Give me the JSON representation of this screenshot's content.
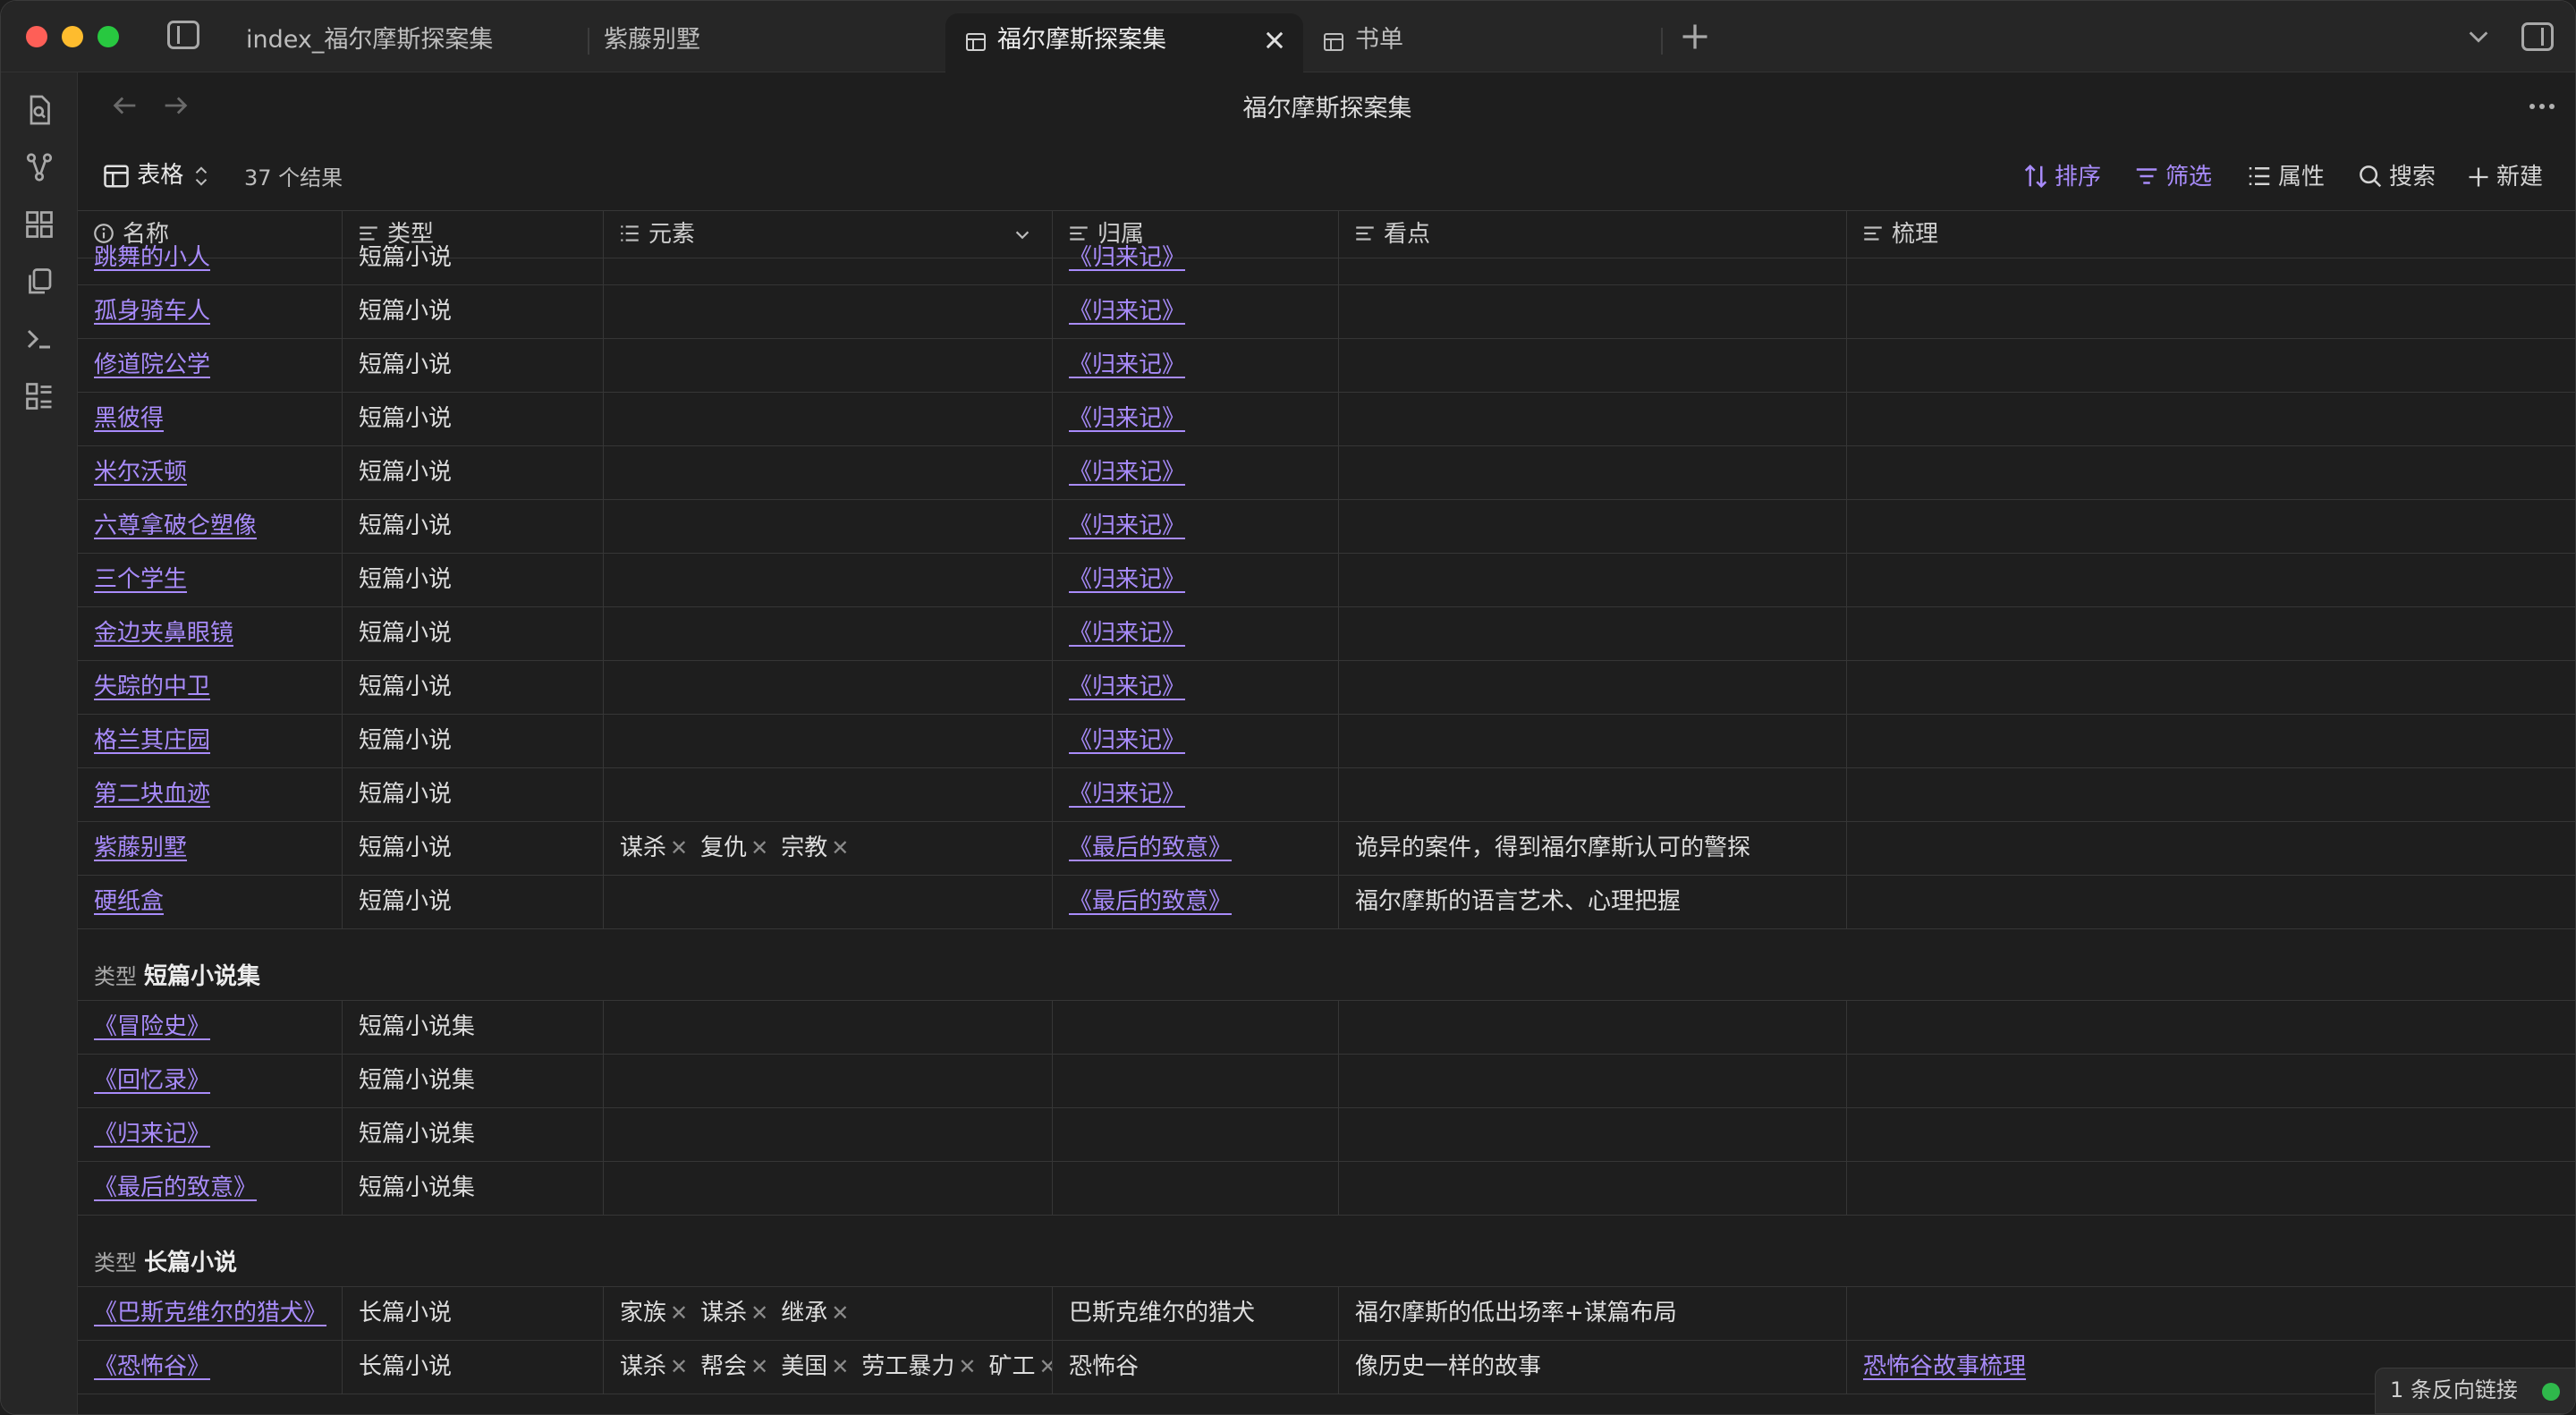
{
  "tabs": [
    {
      "label": "index_福尔摩斯探案集",
      "active": false
    },
    {
      "label": "紫藤别墅",
      "active": false
    },
    {
      "label": "福尔摩斯探案集",
      "active": true
    },
    {
      "label": "书单",
      "active": false
    }
  ],
  "page": {
    "title": "福尔摩斯探案集"
  },
  "toolbar": {
    "view_label": "表格",
    "result_count": "37 个结果",
    "sort_label": "排序",
    "filter_label": "筛选",
    "properties_label": "属性",
    "search_label": "搜索",
    "new_label": "新建"
  },
  "columns": {
    "name": "名称",
    "type": "类型",
    "elements": "元素",
    "belongs": "归属",
    "highlights": "看点",
    "notes": "梳理"
  },
  "rows_group1": [
    {
      "name": "跳舞的小人",
      "type": "短篇小说",
      "elements": [],
      "belongs": "《归来记》",
      "highlights": "",
      "notes": ""
    },
    {
      "name": "孤身骑车人",
      "type": "短篇小说",
      "elements": [],
      "belongs": "《归来记》",
      "highlights": "",
      "notes": ""
    },
    {
      "name": "修道院公学",
      "type": "短篇小说",
      "elements": [],
      "belongs": "《归来记》",
      "highlights": "",
      "notes": ""
    },
    {
      "name": "黑彼得",
      "type": "短篇小说",
      "elements": [],
      "belongs": "《归来记》",
      "highlights": "",
      "notes": ""
    },
    {
      "name": "米尔沃顿",
      "type": "短篇小说",
      "elements": [],
      "belongs": "《归来记》",
      "highlights": "",
      "notes": ""
    },
    {
      "name": "六尊拿破仑塑像",
      "type": "短篇小说",
      "elements": [],
      "belongs": "《归来记》",
      "highlights": "",
      "notes": ""
    },
    {
      "name": "三个学生",
      "type": "短篇小说",
      "elements": [],
      "belongs": "《归来记》",
      "highlights": "",
      "notes": ""
    },
    {
      "name": "金边夹鼻眼镜",
      "type": "短篇小说",
      "elements": [],
      "belongs": "《归来记》",
      "highlights": "",
      "notes": ""
    },
    {
      "name": "失踪的中卫",
      "type": "短篇小说",
      "elements": [],
      "belongs": "《归来记》",
      "highlights": "",
      "notes": ""
    },
    {
      "name": "格兰其庄园",
      "type": "短篇小说",
      "elements": [],
      "belongs": "《归来记》",
      "highlights": "",
      "notes": ""
    },
    {
      "name": "第二块血迹",
      "type": "短篇小说",
      "elements": [],
      "belongs": "《归来记》",
      "highlights": "",
      "notes": ""
    },
    {
      "name": "紫藤别墅",
      "type": "短篇小说",
      "elements": [
        "谋杀",
        "复仇",
        "宗教"
      ],
      "belongs": "《最后的致意》",
      "highlights": "诡异的案件，得到福尔摩斯认可的警探",
      "notes": ""
    },
    {
      "name": "硬纸盒",
      "type": "短篇小说",
      "elements": [],
      "belongs": "《最后的致意》",
      "highlights": "福尔摩斯的语言艺术、心理把握",
      "notes": ""
    }
  ],
  "group2": {
    "label": "类型",
    "value": "短篇小说集"
  },
  "rows_group2": [
    {
      "name": "《冒险史》",
      "type": "短篇小说集"
    },
    {
      "name": "《回忆录》",
      "type": "短篇小说集"
    },
    {
      "name": "《归来记》",
      "type": "短篇小说集"
    },
    {
      "name": "《最后的致意》",
      "type": "短篇小说集"
    }
  ],
  "group3": {
    "label": "类型",
    "value": "长篇小说"
  },
  "rows_group3": [
    {
      "name": "《巴斯克维尔的猎犬》",
      "type": "长篇小说",
      "elements": [
        "家族",
        "谋杀",
        "继承"
      ],
      "belongs": "巴斯克维尔的猎犬",
      "highlights": "福尔摩斯的低出场率+谋篇布局",
      "notes": ""
    },
    {
      "name": "《恐怖谷》",
      "type": "长篇小说",
      "elements": [
        "谋杀",
        "帮会",
        "美国",
        "劳工暴力",
        "矿工"
      ],
      "belongs": "恐怖谷",
      "highlights": "像历史一样的故事",
      "notes": "恐怖谷故事梳理"
    }
  ],
  "backlinks": {
    "label": "1 条反向链接"
  },
  "colors": {
    "accent": "#a88bfa",
    "background": "#1e1e1e",
    "status_ok": "#2fb84b"
  }
}
